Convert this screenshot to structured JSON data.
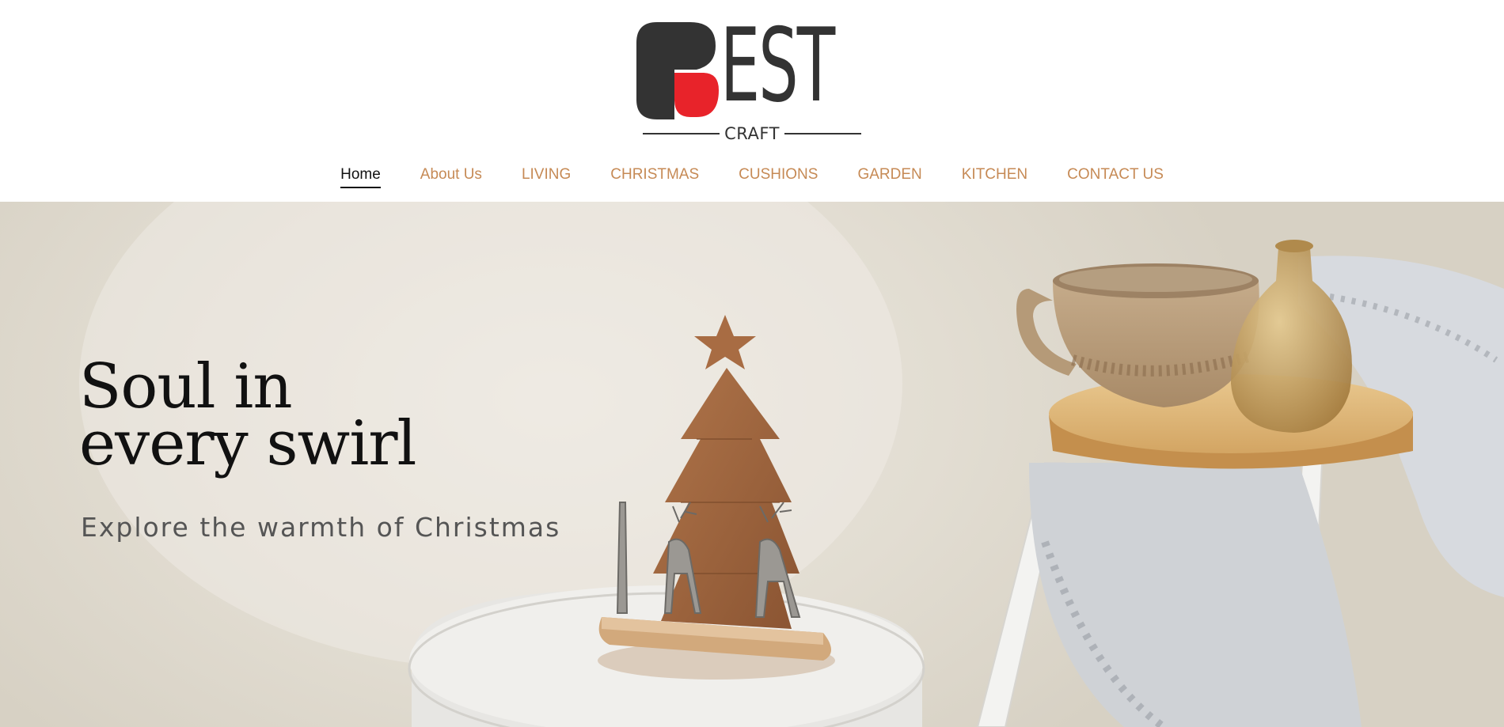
{
  "logo": {
    "wordmark": "EST",
    "subtitle": "CRAFT",
    "colors": {
      "dark": "#333333",
      "accent": "#e8232a"
    }
  },
  "nav": {
    "items": [
      {
        "label": "Home",
        "active": true
      },
      {
        "label": "About Us"
      },
      {
        "label": "LIVING"
      },
      {
        "label": "CHRISTMAS"
      },
      {
        "label": "CUSHIONS"
      },
      {
        "label": "GARDEN"
      },
      {
        "label": "KITCHEN"
      },
      {
        "label": "CONTACT US"
      }
    ],
    "colors": {
      "link": "#c68a55",
      "active": "#111111"
    }
  },
  "hero": {
    "title_line1": "Soul in",
    "title_line2": "every swirl",
    "subtitle": "Explore the warmth of Christmas"
  }
}
